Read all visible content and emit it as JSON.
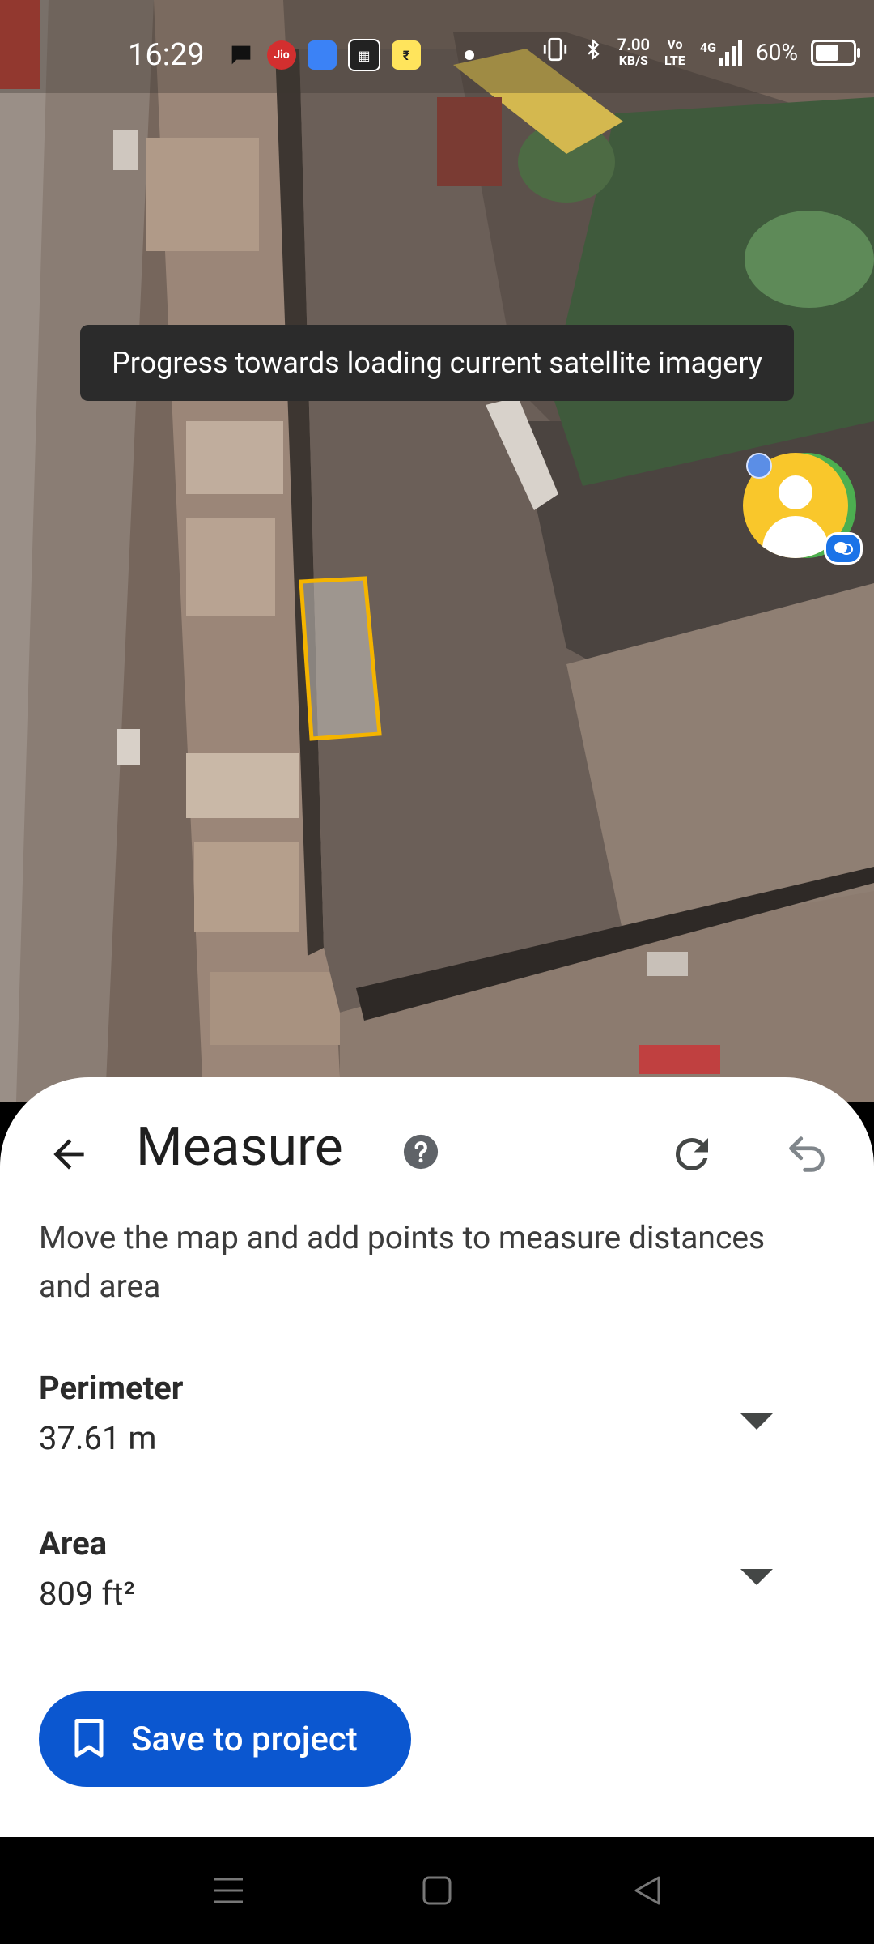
{
  "status_bar": {
    "time": "16:29",
    "net_speed_value": "7.00",
    "net_speed_unit": "KB/S",
    "volte": "Vo LTE",
    "network": "4G",
    "battery_percent": "60%",
    "apps": [
      "chat-icon",
      "jio-icon",
      "app-icon",
      "calculator-icon",
      "wallet-icon"
    ]
  },
  "tooltip": {
    "text": "Progress towards loading current satellite imagery"
  },
  "sheet": {
    "title": "Measure",
    "instructions": "Move the map and add points to measure distances and area",
    "metrics": [
      {
        "label": "Perimeter",
        "value": "37.61 m"
      },
      {
        "label": "Area",
        "value": "809 ft²"
      }
    ],
    "save_button_label": "Save to project"
  },
  "colors": {
    "accent": "#0b57d0",
    "measure_outline": "#f4b400",
    "avatar": "#f9c72b"
  }
}
